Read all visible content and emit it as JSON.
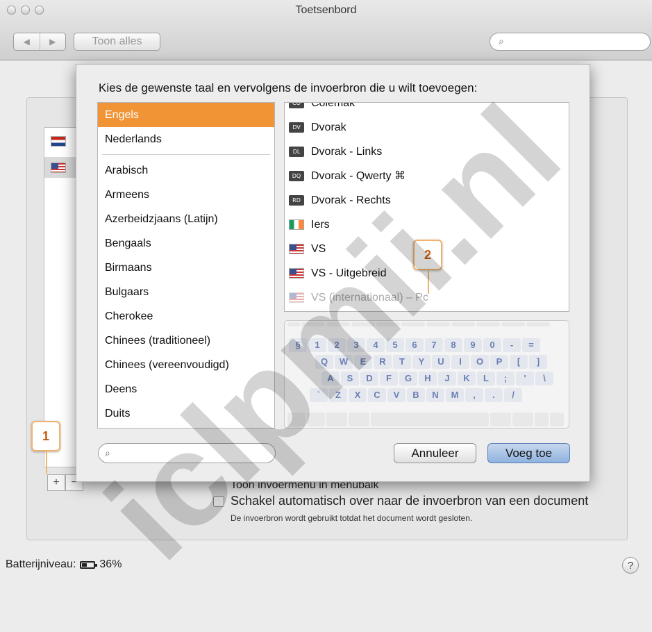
{
  "window": {
    "title": "Toetsenbord"
  },
  "toolbar": {
    "back": "◀",
    "forward": "▶",
    "show_all": "Toon alles",
    "search_placeholder": ""
  },
  "sheet": {
    "prompt": "Kies de gewenste taal en vervolgens de invoerbron die u wilt toevoegen:",
    "languages_top": [
      "Engels",
      "Nederlands"
    ],
    "languages": [
      "Arabisch",
      "Armeens",
      "Azerbeidzjaans (Latijn)",
      "Bengaals",
      "Birmaans",
      "Bulgaars",
      "Cherokee",
      "Chinees (traditioneel)",
      "Chinees (vereenvoudigd)",
      "Deens",
      "Duits"
    ],
    "sources": [
      {
        "label": "Colemak",
        "icon": "keyboard-layout-icon",
        "badge": "CO"
      },
      {
        "label": "Dvorak",
        "icon": "keyboard-layout-icon",
        "badge": "DV"
      },
      {
        "label": "Dvorak - Links",
        "icon": "keyboard-layout-icon",
        "badge": "DL"
      },
      {
        "label": "Dvorak - Qwerty ⌘",
        "icon": "keyboard-layout-icon",
        "badge": "DQ"
      },
      {
        "label": "Dvorak - Rechts",
        "icon": "keyboard-layout-icon",
        "badge": "RD"
      },
      {
        "label": "Iers",
        "icon": "irish-flag-icon"
      },
      {
        "label": "VS",
        "icon": "us-flag-icon"
      },
      {
        "label": "VS - Uitgebreid",
        "icon": "us-flag-icon"
      },
      {
        "label": "VS (internationaal) – Pc",
        "icon": "us-flag-icon"
      }
    ],
    "keyboard_rows": [
      [
        "§",
        "1",
        "2",
        "3",
        "4",
        "5",
        "6",
        "7",
        "8",
        "9",
        "0",
        "-",
        "="
      ],
      [
        "Q",
        "W",
        "E",
        "R",
        "T",
        "Y",
        "U",
        "I",
        "O",
        "P",
        "[",
        "]"
      ],
      [
        "A",
        "S",
        "D",
        "F",
        "G",
        "H",
        "J",
        "K",
        "L",
        ";",
        "'",
        "\\"
      ],
      [
        "`",
        "Z",
        "X",
        "C",
        "V",
        "B",
        "N",
        "M",
        ",",
        ".",
        "/"
      ]
    ],
    "cancel": "Annuleer",
    "add": "Voeg toe"
  },
  "pane": {
    "add_button": "+",
    "remove_button": "−",
    "option_menu": "Toon invoermenu in menubalk",
    "option_switch": "Schakel automatisch over naar de invoerbron van een document",
    "option_switch_note": "De invoerbron wordt gebruikt totdat het document wordt gesloten."
  },
  "status": {
    "battery_label": "Batterijniveau:",
    "battery_value": "36%",
    "help": "?"
  },
  "callouts": {
    "one": "1",
    "two": "2"
  },
  "watermark": "iclpmii.nl",
  "colors": {
    "selection": "#f09436",
    "callout_border": "#f0b36b",
    "callout_text": "#c45a0a"
  }
}
